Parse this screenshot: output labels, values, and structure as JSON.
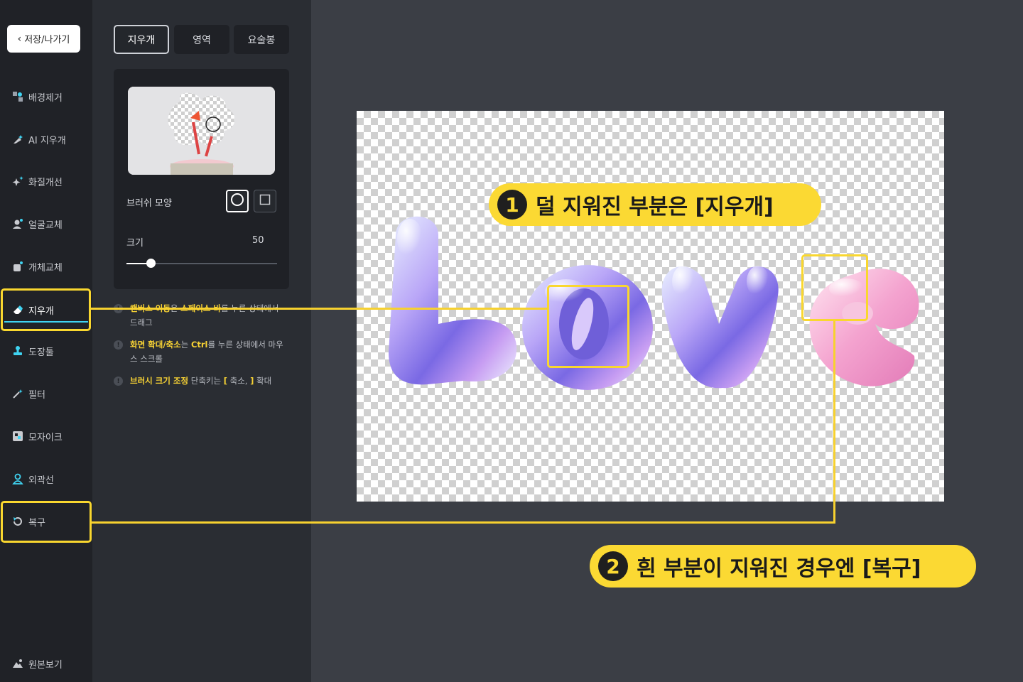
{
  "sidebar": {
    "back_label": "저장/나가기",
    "items": [
      {
        "label": "배경제거",
        "icon": "background-remove-icon"
      },
      {
        "label": "AI 지우개",
        "icon": "ai-eraser-icon"
      },
      {
        "label": "화질개선",
        "icon": "sparkle-icon"
      },
      {
        "label": "얼굴교체",
        "icon": "face-swap-icon"
      },
      {
        "label": "개체교체",
        "icon": "object-swap-icon"
      },
      {
        "label": "지우개",
        "icon": "eraser-icon",
        "active": true
      },
      {
        "label": "도장툴",
        "icon": "stamp-icon"
      },
      {
        "label": "필터",
        "icon": "filter-icon"
      },
      {
        "label": "모자이크",
        "icon": "mosaic-icon"
      },
      {
        "label": "외곽선",
        "icon": "outline-icon"
      },
      {
        "label": "복구",
        "icon": "restore-icon"
      }
    ],
    "original_label": "원본보기"
  },
  "panel": {
    "tabs": [
      "지우개",
      "영역",
      "요술봉"
    ],
    "active_tab": "지우개",
    "brush_shape_label": "브러쉬 모양",
    "size_label": "크기",
    "size_value": "50",
    "size_fraction": 0.16,
    "tips": [
      {
        "hl1": "캔버스 이동",
        "t1": "은 ",
        "hl2": "스페이스 바",
        "t2": "를 누른 상태에서 드래그"
      },
      {
        "hl1": "화면 확대/축소",
        "t1": "는 ",
        "hl2": "Ctrl",
        "t2": "를 누른 상태에서 마우스 스크롤"
      },
      {
        "hl1": "브러시 크기 조정",
        "t1": " 단축키는 ",
        "hl2": "[",
        "t2": " 축소, ",
        "hl3": "]",
        "t3": " 확대"
      }
    ]
  },
  "canvas": {
    "word": "Love"
  },
  "callouts": [
    {
      "number": "1",
      "text": "덜 지워진 부분은 [지우개]"
    },
    {
      "number": "2",
      "text": "흰 부분이 지워진 경우엔 [복구]"
    }
  ],
  "colors": {
    "highlight": "#f9d72f",
    "active_underline": "#3fd3f1"
  }
}
